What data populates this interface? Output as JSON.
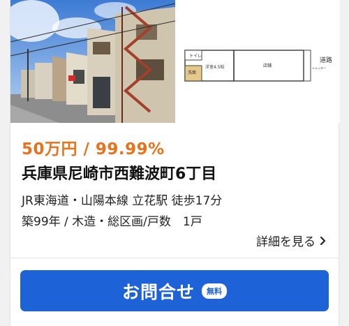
{
  "listing": {
    "price": "50万円 / 99.99%",
    "address": "兵庫県尼崎市西難波町6丁目",
    "access": "JR東海道・山陽本線 立花駅 徒歩17分",
    "details": "築99年 / 木造・総区画/戸数　1戸",
    "more_label": "詳細を見る"
  },
  "floor_plan": {
    "toilet": "トイレ",
    "washroom": "洗面",
    "washitsu": "洋室4.5帖",
    "shop": "店舗",
    "road": "道路",
    "shutter": "シャッター"
  },
  "cta": {
    "label": "お問合せ",
    "badge": "無料"
  },
  "colors": {
    "price": "#e8731c",
    "cta_background": "#1d62d6"
  }
}
